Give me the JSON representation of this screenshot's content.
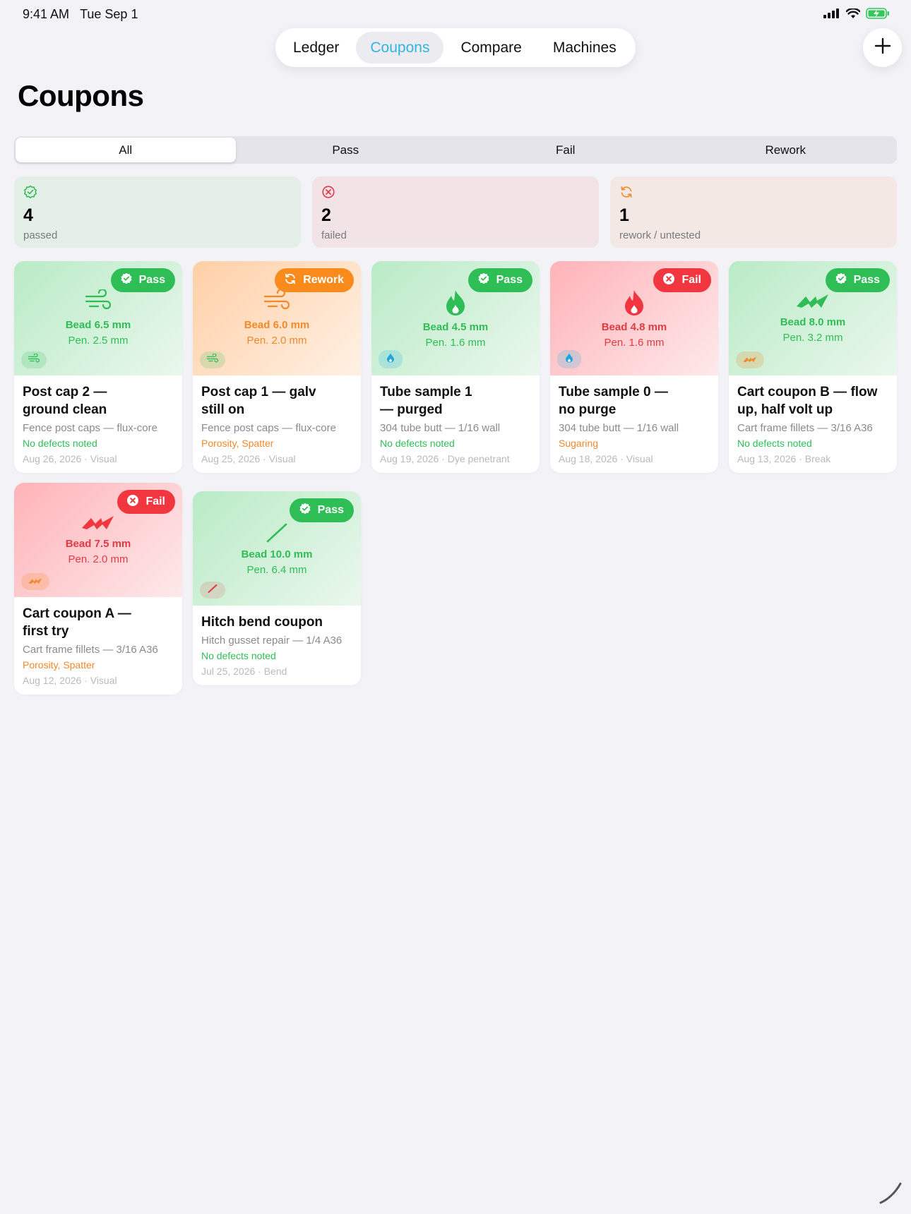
{
  "status_bar": {
    "time": "9:41 AM",
    "date": "Tue Sep 1"
  },
  "nav": {
    "tabs": [
      {
        "label": "Ledger",
        "active": false
      },
      {
        "label": "Coupons",
        "active": true
      },
      {
        "label": "Compare",
        "active": false
      },
      {
        "label": "Machines",
        "active": false
      }
    ],
    "add_icon": "plus-icon"
  },
  "page_title": "Coupons",
  "filter": {
    "segments": [
      "All",
      "Pass",
      "Fail",
      "Rework"
    ],
    "selected": "All"
  },
  "summary": [
    {
      "count": "4",
      "label": "passed",
      "icon": "checkmark-seal-icon",
      "color": "#2fbe56"
    },
    {
      "count": "2",
      "label": "failed",
      "icon": "x-circle-icon",
      "color": "#e23a44"
    },
    {
      "count": "1",
      "label": "rework / untested",
      "icon": "refresh-icon",
      "color": "#f2892a"
    }
  ],
  "coupons": [
    {
      "title_line1": "Post cap 2 —",
      "title_line2": "ground clean",
      "project": "Fence post caps — flux-core",
      "defects": "No defects noted",
      "date_method": "Aug 26, 2026 · Visual",
      "status": "Pass",
      "bead": "Bead 6.5 mm",
      "pen": "Pen. 2.5 mm",
      "icon": "wind-icon",
      "chip_icon": "wind-icon"
    },
    {
      "title_line1": "Post cap 1 — galv",
      "title_line2": "still on",
      "project": "Fence post caps — flux-core",
      "defects": "Porosity, Spatter",
      "date_method": "Aug 25, 2026 · Visual",
      "status": "Rework",
      "bead": "Bead 6.0 mm",
      "pen": "Pen. 2.0 mm",
      "icon": "wind-icon",
      "chip_icon": "wind-icon"
    },
    {
      "title_line1": "Tube sample 1",
      "title_line2": "— purged",
      "project": "304 tube butt — 1/16 wall",
      "defects": "No defects noted",
      "date_method": "Aug 19, 2026 · Dye penetrant",
      "status": "Pass",
      "bead": "Bead 4.5 mm",
      "pen": "Pen. 1.6 mm",
      "icon": "flame-icon",
      "chip_icon": "droplet-icon"
    },
    {
      "title_line1": "Tube sample 0 —",
      "title_line2": "no purge",
      "project": "304 tube butt — 1/16 wall",
      "defects": "Sugaring",
      "date_method": "Aug 18, 2026 · Visual",
      "status": "Fail",
      "bead": "Bead 4.8 mm",
      "pen": "Pen. 1.6 mm",
      "icon": "flame-icon",
      "chip_icon": "droplet-icon"
    },
    {
      "title_line1": "Cart coupon B — flow",
      "title_line2": "up, half volt up",
      "project": "Cart frame fillets — 3/16 A36",
      "defects": "No defects noted",
      "date_method": "Aug 13, 2026 · Break",
      "status": "Pass",
      "bead": "Bead 8.0 mm",
      "pen": "Pen. 3.2 mm",
      "icon": "zigzag-icon",
      "chip_icon": "zigzag-icon"
    },
    {
      "title_line1": "Cart coupon A —",
      "title_line2": "first try",
      "project": "Cart frame fillets — 3/16 A36",
      "defects": "Porosity, Spatter",
      "date_method": "Aug 12, 2026 · Visual",
      "status": "Fail",
      "bead": "Bead 7.5 mm",
      "pen": "Pen. 2.0 mm",
      "icon": "zigzag-icon",
      "chip_icon": "zigzag-icon"
    },
    {
      "title_line1": "Hitch bend coupon",
      "title_line2": "",
      "project": "Hitch gusset repair — 1/4 A36",
      "defects": "No defects noted",
      "date_method": "Jul 25, 2026 · Bend",
      "status": "Pass",
      "bead": "Bead 10.0 mm",
      "pen": "Pen. 6.4 mm",
      "icon": "slash-line-icon",
      "chip_icon": "slash-line-icon"
    }
  ],
  "colors": {
    "pass": "#2fbe56",
    "fail": "#f2363f",
    "rework": "#f98a1c",
    "accent": "#30b6e0"
  }
}
